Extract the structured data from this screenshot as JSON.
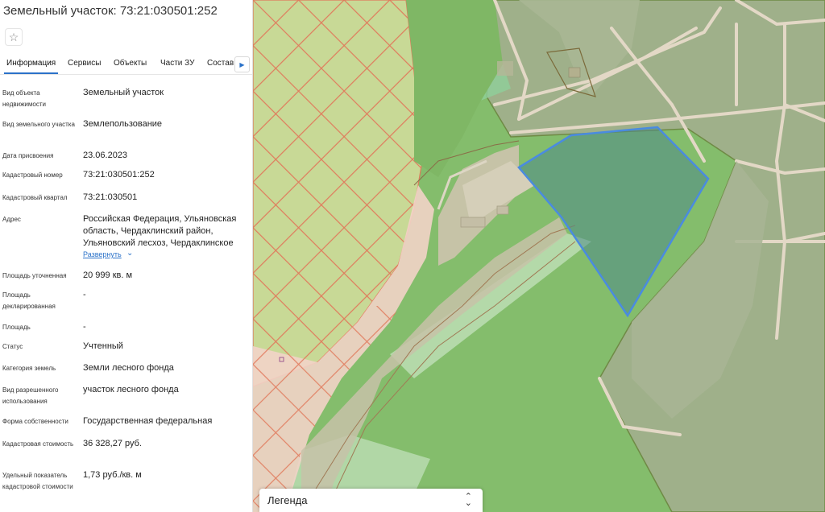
{
  "header": {
    "title": "Земельный участок: 73:21:030501:252"
  },
  "tabs": [
    {
      "label": "Информация",
      "active": true
    },
    {
      "label": "Сервисы"
    },
    {
      "label": "Объекты"
    },
    {
      "label": "Части ЗУ"
    },
    {
      "label": "Состав"
    }
  ],
  "properties": [
    {
      "label": "Вид объекта недвижимости",
      "value": "Земельный участок"
    },
    {
      "label": "Вид земельного участка",
      "value": "Землепользование"
    },
    {
      "label": "Дата присвоения",
      "value": "23.06.2023"
    },
    {
      "label": "Кадастровый номер",
      "value": "73:21:030501:252"
    },
    {
      "label": "Кадастровый квартал",
      "value": "73:21:030501"
    },
    {
      "label": "Адрес",
      "value": "Российская Федерация, Ульяновская область, Чердаклинский район, Ульяновский лесхоз, Чердаклинское"
    },
    {
      "label": "Площадь уточненная",
      "value": "20 999 кв. м"
    },
    {
      "label": "Площадь декларированная",
      "value": "-"
    },
    {
      "label": "Площадь",
      "value": "-"
    },
    {
      "label": "Статус",
      "value": "Учтенный"
    },
    {
      "label": "Категория земель",
      "value": "Земли лесного фонда"
    },
    {
      "label": "Вид разрешенного использования",
      "value": "участок лесного фонда"
    },
    {
      "label": "Форма собственности",
      "value": "Государственная федеральная"
    },
    {
      "label": "Кадастровая стоимость",
      "value": "36 328,27 руб."
    },
    {
      "label": "Удельный показатель кадастровой стоимости",
      "value": "1,73 руб./кв. м"
    }
  ],
  "expand_label": "Развернуть",
  "legend": {
    "label": "Легенда"
  },
  "colors": {
    "accent": "#2b72c9",
    "selected_parcel": "#4a8be0"
  }
}
